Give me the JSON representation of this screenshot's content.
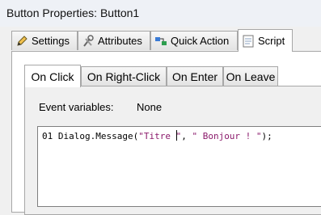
{
  "window": {
    "title": "Button Properties: Button1"
  },
  "tabs": [
    {
      "label": "Settings",
      "icon": "pencil-icon"
    },
    {
      "label": "Attributes",
      "icon": "tools-icon"
    },
    {
      "label": "Quick Action",
      "icon": "quick-action-icon"
    },
    {
      "label": "Script",
      "icon": "script-icon",
      "active": true
    }
  ],
  "subtabs": [
    {
      "label": "On Click",
      "active": true
    },
    {
      "label": "On Right-Click"
    },
    {
      "label": "On Enter"
    },
    {
      "label": "On Leave"
    }
  ],
  "event_variables": {
    "label": "Event variables:",
    "value": "None"
  },
  "code": {
    "line_number": "01",
    "call": "Dialog.Message(",
    "arg1_before_caret": "\"Titre ",
    "arg1_after_caret": "\"",
    "separator": ", ",
    "arg2": "\" Bonjour ! \"",
    "end": ");"
  },
  "colors": {
    "string": "#8b1a6b",
    "active_tab": "#ffffff",
    "window_bg": "#f0f0f0"
  }
}
